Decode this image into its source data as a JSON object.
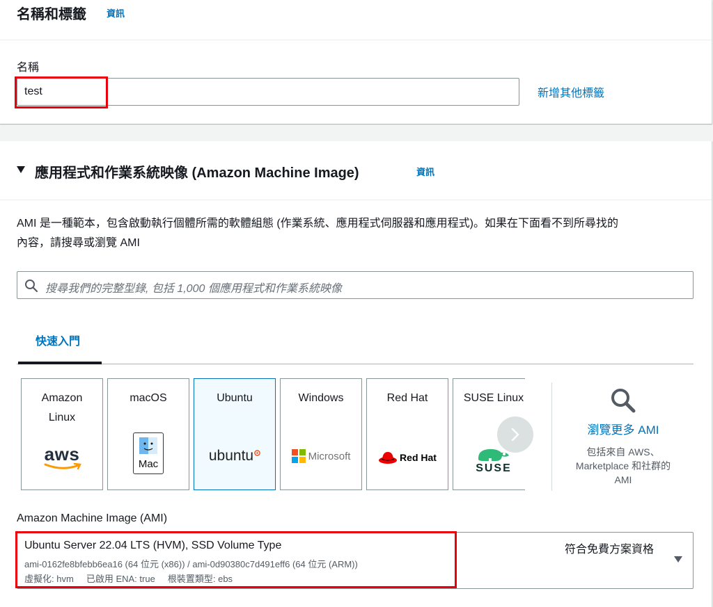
{
  "tags_section": {
    "title": "名稱和標籤",
    "info": "資訊",
    "name_label": "名稱",
    "name_value": "test",
    "add_tags_link": "新增其他標籤"
  },
  "ami_section": {
    "title": "應用程式和作業系統映像 (Amazon Machine Image)",
    "info": "資訊",
    "description_line1": "AMI 是一種範本，包含啟動執行個體所需的軟體組態 (作業系統、應用程式伺服器和應用程式)。如果在下面看不到所尋找的",
    "description_line2": "內容，請搜尋或瀏覽 AMI",
    "search_placeholder": "搜尋我們的完整型錄, 包括 1,000 個應用程式和作業系統映像",
    "tab_quick_start": "快速入門",
    "os_tiles": [
      {
        "line1": "Amazon",
        "line2": "Linux",
        "logo": "aws"
      },
      {
        "line1": "macOS",
        "line2": "",
        "logo": "Mac"
      },
      {
        "line1": "Ubuntu",
        "line2": "",
        "logo": "ubuntu"
      },
      {
        "line1": "Windows",
        "line2": "",
        "logo": "Microsoft"
      },
      {
        "line1": "Red Hat",
        "line2": "",
        "logo": "Red Hat"
      },
      {
        "line1": "SUSE Linux",
        "line2": "",
        "logo": "SUSE"
      }
    ],
    "selected_os": "Ubuntu",
    "browse_more": "瀏覽更多 AMI",
    "browse_desc_line1": "包括來自 AWS、",
    "browse_desc_line2": "Marketplace 和社群的",
    "browse_desc_line3": "AMI",
    "ami_label": "Amazon Machine Image (AMI)",
    "ami_selected": {
      "title": "Ubuntu Server 22.04 LTS (HVM), SSD Volume Type",
      "ids": "ami-0162fe8bfebb6ea16 (64 位元 (x86)) / ami-0d90380c7d491eff6 (64 位元 (ARM))",
      "meta": "虛擬化: hvm     已啟用 ENA: true     根裝置類型: ebs",
      "free_tier": "符合免費方案資格"
    }
  },
  "colors": {
    "link": "#0073bb",
    "highlight_box": "#e8000b",
    "selected_tile_bg": "#f1faff"
  }
}
